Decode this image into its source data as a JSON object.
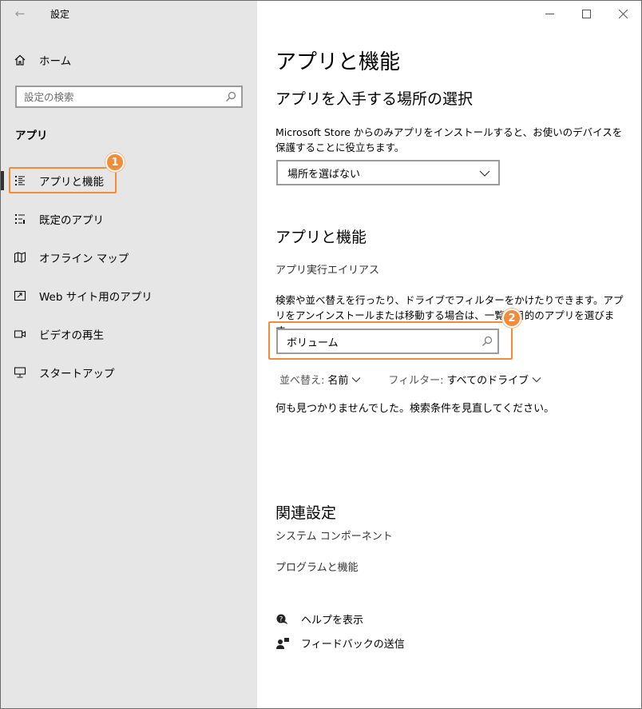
{
  "window": {
    "app_title": "設定",
    "back_glyph": "←",
    "controls": {
      "minimize": "—",
      "maximize": "☐",
      "close": "✕"
    }
  },
  "sidebar": {
    "home_label": "ホーム",
    "search_placeholder": "設定の検索",
    "section_title": "アプリ",
    "items": [
      {
        "label": "アプリと機能",
        "icon": "apps-features-icon",
        "active": true
      },
      {
        "label": "既定のアプリ",
        "icon": "default-apps-icon"
      },
      {
        "label": "オフライン マップ",
        "icon": "offline-maps-icon"
      },
      {
        "label": "Web サイト用のアプリ",
        "icon": "apps-for-websites-icon"
      },
      {
        "label": "ビデオの再生",
        "icon": "video-playback-icon"
      },
      {
        "label": "スタートアップ",
        "icon": "startup-icon"
      }
    ]
  },
  "annotations": {
    "badge1": "1",
    "badge2": "2",
    "accent": "#f28c3a"
  },
  "main": {
    "title": "アプリと機能",
    "install_section": {
      "heading": "アプリを入手する場所の選択",
      "description": "Microsoft Store からのみアプリをインストールすると、お使いのデバイスを保護することに役立ちます。",
      "dropdown_value": "場所を選ばない"
    },
    "features_section": {
      "heading": "アプリと機能",
      "alias_link": "アプリ実行エイリアス",
      "description": "検索や並べ替えを行ったり、ドライブでフィルターをかけたりできます。アプリをアンインストールまたは移動する場合は、一覧で目的のアプリを選びます。",
      "search_value": "ボリューム",
      "sort_label": "並べ替え:",
      "sort_value": "名前",
      "filter_label": "フィルター:",
      "filter_value": "すべてのドライブ",
      "empty_message": "何も見つかりませんでした。検索条件を見直してください。"
    },
    "related_section": {
      "heading": "関連設定",
      "links": [
        "システム コンポーネント",
        "プログラムと機能"
      ]
    },
    "help": {
      "get_help": "ヘルプを表示",
      "feedback": "フィードバックの送信"
    }
  }
}
